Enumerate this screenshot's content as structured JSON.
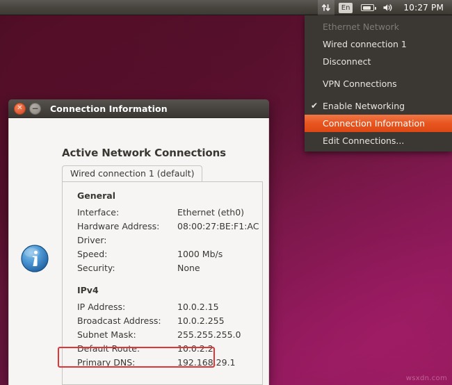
{
  "panel": {
    "network_icon": "network-updown-icon",
    "keyboard_layout": "En",
    "battery_icon": "battery-icon",
    "volume_icon": "volume-icon",
    "clock": "10:27 PM"
  },
  "network_menu": {
    "items": [
      {
        "label": "Ethernet Network",
        "state": "disabled",
        "checked": false
      },
      {
        "label": "Wired connection 1",
        "state": "normal",
        "checked": false
      },
      {
        "label": "Disconnect",
        "state": "normal",
        "checked": false
      },
      {
        "separator": true
      },
      {
        "label": "VPN Connections",
        "state": "normal",
        "checked": false
      },
      {
        "separator": true
      },
      {
        "label": "Enable Networking",
        "state": "normal",
        "checked": true
      },
      {
        "label": "Connection Information",
        "state": "selected",
        "checked": false
      },
      {
        "label": "Edit Connections...",
        "state": "normal",
        "checked": false
      }
    ],
    "check_glyph": "✔",
    "highlight_color": "#dd4814"
  },
  "dialog": {
    "title": "Connection Information",
    "close_glyph": "✕",
    "minimize_glyph": "−",
    "heading": "Active Network Connections",
    "info_icon": "info-icon",
    "tab": {
      "label": "Wired connection 1 (default)"
    },
    "sections": [
      {
        "title": "General",
        "rows": [
          {
            "key": "Interface:",
            "value": "Ethernet (eth0)"
          },
          {
            "key": "Hardware Address:",
            "value": "08:00:27:BE:F1:AC"
          },
          {
            "key": "Driver:",
            "value": ""
          },
          {
            "key": "Speed:",
            "value": "1000 Mb/s"
          },
          {
            "key": "Security:",
            "value": "None"
          }
        ]
      },
      {
        "title": "IPv4",
        "rows": [
          {
            "key": "IP Address:",
            "value": "10.0.2.15"
          },
          {
            "key": "Broadcast Address:",
            "value": "10.0.2.255"
          },
          {
            "key": "Subnet Mask:",
            "value": "255.255.255.0"
          },
          {
            "key": "Default Route:",
            "value": "10.0.2.2",
            "highlighted": true
          },
          {
            "key": "Primary DNS:",
            "value": "192.168.29.1"
          }
        ]
      }
    ]
  },
  "annotation": {
    "highlight_color": "#e03535"
  },
  "desktop": {
    "watermark": "wsxdn.com"
  }
}
